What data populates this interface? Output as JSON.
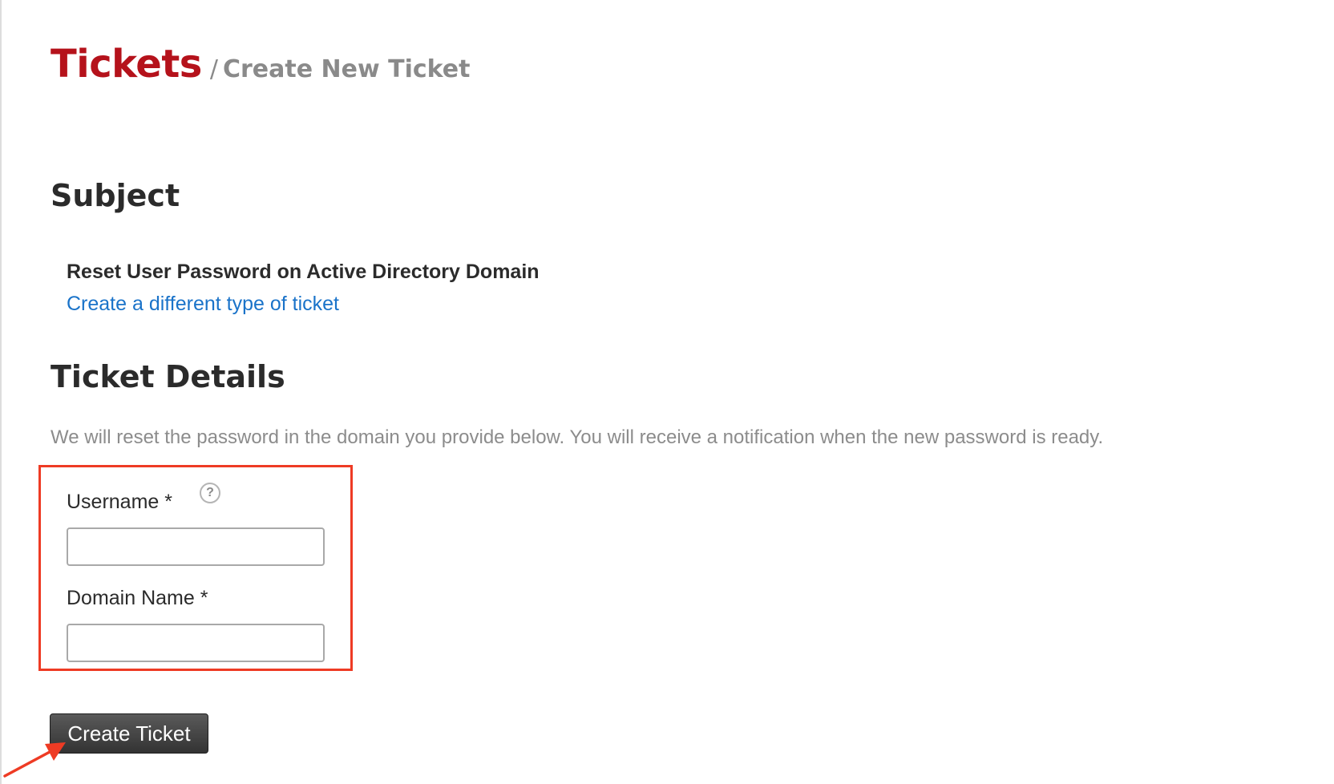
{
  "header": {
    "section": "Tickets",
    "separator": "/",
    "page": "Create New Ticket"
  },
  "subject": {
    "title": "Subject",
    "ticket_type": "Reset User Password on Active Directory Domain",
    "change_link": "Create a different type of ticket"
  },
  "details": {
    "title": "Ticket Details",
    "description": "We will reset the password in the domain you provide below. You will receive a notification when the new password is ready.",
    "fields": [
      {
        "label": "Username *",
        "value": ""
      },
      {
        "label": "Domain Name *",
        "value": ""
      }
    ],
    "help_icon": "question-circle-icon"
  },
  "actions": {
    "submit_label": "Create Ticket"
  },
  "annotations": {
    "highlight_color": "#ee3b24",
    "arrow_color": "#ee3b24"
  },
  "colors": {
    "brand": "#b5121b",
    "link": "#1a73c9",
    "muted": "#8c8c8c",
    "button": "#3f3f3f"
  }
}
